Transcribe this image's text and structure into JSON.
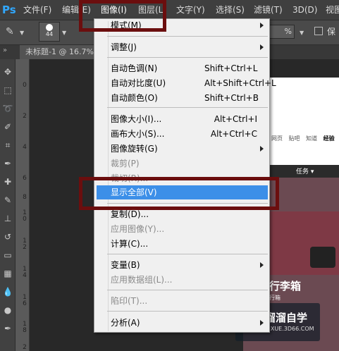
{
  "app": {
    "logo": "Ps"
  },
  "menubar": {
    "items": [
      "文件(F)",
      "编辑(E)",
      "图像(I)",
      "图层(L)",
      "文字(Y)",
      "选择(S)",
      "滤镜(T)",
      "3D(D)",
      "视图"
    ]
  },
  "optbar": {
    "brush_size": "44",
    "zoom": "%",
    "checkbox_label": "保"
  },
  "tab": {
    "title": "未标题-1 @ 16.7%"
  },
  "ruler": {
    "nums": [
      "0",
      "2",
      "4",
      "6",
      "8",
      "1\n0",
      "1\n2",
      "1\n4",
      "1\n6",
      "1\n8",
      "2"
    ]
  },
  "menu": {
    "items": [
      {
        "label": "模式(M)",
        "submenu": true
      },
      {
        "label": "调整(J)",
        "submenu": true
      },
      {
        "label": "自动色调(N)",
        "shortcut": "Shift+Ctrl+L"
      },
      {
        "label": "自动对比度(U)",
        "shortcut": "Alt+Shift+Ctrl+L"
      },
      {
        "label": "自动颜色(O)",
        "shortcut": "Shift+Ctrl+B"
      },
      {
        "label": "图像大小(I)...",
        "shortcut": "Alt+Ctrl+I"
      },
      {
        "label": "画布大小(S)...",
        "shortcut": "Alt+Ctrl+C"
      },
      {
        "label": "图像旋转(G)",
        "submenu": true
      },
      {
        "label": "裁剪(P)",
        "disabled": true
      },
      {
        "label": "裁切(R)...",
        "disabled": true
      },
      {
        "label": "显示全部(V)",
        "highlighted": true
      },
      {
        "label": "复制(D)..."
      },
      {
        "label": "应用图像(Y)...",
        "disabled": true
      },
      {
        "label": "计算(C)..."
      },
      {
        "label": "变量(B)",
        "submenu": true
      },
      {
        "label": "应用数据组(L)...",
        "disabled": true
      },
      {
        "label": "陷印(T)...",
        "disabled": true
      },
      {
        "label": "分析(A)",
        "submenu": true
      }
    ]
  },
  "document": {
    "nav": [
      "网页",
      "贴吧",
      "知道",
      "经验"
    ],
    "hero_tab": "任务 ▾",
    "hero_title": "打包行李箱",
    "hero_sub": "旅行箱"
  },
  "watermark": {
    "title": "溜溜自学",
    "url": "ZIXUE.3D66.COM"
  },
  "colors": {
    "highlight": "#3c8fe8",
    "annotation_box": "#6b0e0e",
    "menu_bg": "#f0f0f0",
    "ps_blue": "#31a8ff"
  }
}
